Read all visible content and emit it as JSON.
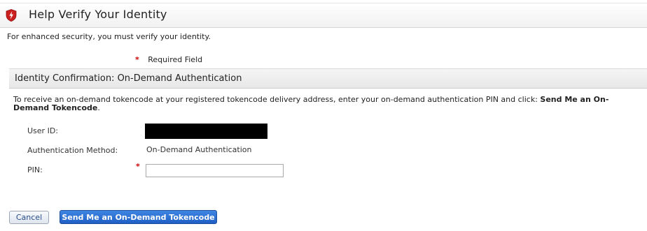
{
  "header": {
    "title": "Help Verify Your Identity",
    "icon": "shield-icon",
    "icon_color": "#cc1f1f"
  },
  "intro_text": "For enhanced security, you must verify your identity.",
  "required_legend": {
    "marker": "*",
    "label": "Required Field"
  },
  "section": {
    "title": "Identity Confirmation: On-Demand Authentication",
    "instructions_prefix": "To receive an on-demand tokencode at your registered tokencode delivery address, enter your on-demand authentication PIN and click: ",
    "instructions_bold": "Send Me an On-Demand Tokencode",
    "instructions_suffix": "."
  },
  "fields": {
    "user_id": {
      "label": "User ID:"
    },
    "auth_method": {
      "label": "Authentication Method:",
      "value": "On-Demand Authentication"
    },
    "pin": {
      "label": "PIN:",
      "required_marker": "*",
      "value": ""
    }
  },
  "buttons": {
    "cancel": "Cancel",
    "send": "Send Me an On-Demand Tokencode"
  },
  "colors": {
    "required": "#cc0000",
    "primary_button": "#2a6fd6"
  }
}
